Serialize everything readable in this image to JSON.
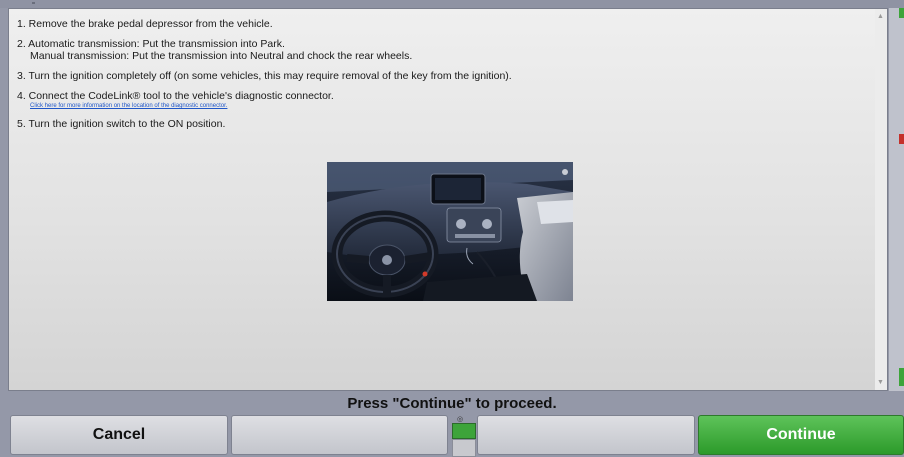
{
  "instructions": {
    "step1": "1. Remove the brake pedal depressor from the vehicle.",
    "step2_line1": "2. Automatic transmission: Put the transmission into Park.",
    "step2_line2": "Manual transmission: Put the transmission into Neutral and chock the rear wheels.",
    "step3": "3. Turn the ignition completely off (on some vehicles, this may require removal of the key from the ignition).",
    "step4": "4. Connect the CodeLink® tool to the vehicle's diagnostic connector.",
    "step4_link": "Click here for more information on the location of the diagnostic connector.",
    "step5": "5. Turn the ignition switch to the ON position."
  },
  "prompt": "Press \"Continue\" to proceed.",
  "buttons": {
    "cancel": "Cancel",
    "continue": "Continue",
    "continue_color": "#3aa83a"
  },
  "icons": {
    "scroll_up": "scroll-up-arrow",
    "scroll_down": "scroll-down-arrow",
    "center_indicator": "magnifier-icon"
  }
}
